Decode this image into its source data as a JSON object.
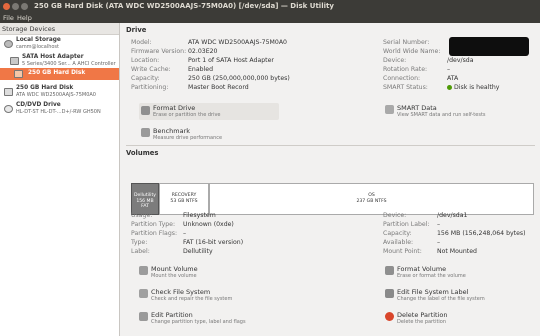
{
  "window": {
    "title": "250 GB Hard Disk (ATA WDC WD2500AAJS-75M0A0) [/dev/sda] — Disk Utility"
  },
  "menu": {
    "file": "File",
    "help": "Help"
  },
  "sidebar": {
    "header": "Storage Devices",
    "items": [
      {
        "name": "Local Storage",
        "sub": "camm@localhost"
      },
      {
        "name": "SATA Host Adapter",
        "sub": "5 Series/3400 Ser... A AHCI Controller"
      },
      {
        "name": "250 GB Hard Disk",
        "sub": ""
      },
      {
        "name": "250 GB Hard Disk",
        "sub": "ATA WDC WD2500AAJS-75M0A0"
      },
      {
        "name": "CD/DVD Drive",
        "sub": "HL-DT-ST HL-DT-...D+/-RW GH50N"
      }
    ]
  },
  "drive": {
    "section": "Drive",
    "left": [
      {
        "label": "Model:",
        "value": "ATA WDC WD2500AAJS-75M0A0"
      },
      {
        "label": "Firmware Version:",
        "value": "02.03E20"
      },
      {
        "label": "Location:",
        "value": "Port 1 of SATA Host Adapter"
      },
      {
        "label": "Write Cache:",
        "value": "Enabled"
      },
      {
        "label": "Capacity:",
        "value": "250 GB (250,000,000,000 bytes)"
      },
      {
        "label": "Partitioning:",
        "value": "Master Boot Record"
      }
    ],
    "right": [
      {
        "label": "Serial Number:",
        "value": ""
      },
      {
        "label": "World Wide Name:",
        "value": ""
      },
      {
        "label": "Device:",
        "value": "/dev/sda"
      },
      {
        "label": "Rotation Rate:",
        "value": "–"
      },
      {
        "label": "Connection:",
        "value": "ATA"
      },
      {
        "label": "SMART Status:",
        "value": "Disk is healthy"
      }
    ],
    "actions": [
      {
        "title": "Format Drive",
        "sub": "Erase or partition the drive"
      },
      {
        "title": "SMART Data",
        "sub": "View SMART data and run self-tests"
      },
      {
        "title": "Benchmark",
        "sub": "Measure drive performance"
      }
    ]
  },
  "volumes": {
    "section": "Volumes",
    "map": [
      {
        "name": "Dellutility",
        "size": "156 MB FAT"
      },
      {
        "name": "RECOVERY",
        "size": "53 GB NTFS"
      },
      {
        "name": "OS",
        "size": "237 GB NTFS"
      }
    ],
    "left": [
      {
        "label": "Usage:",
        "value": "Filesystem"
      },
      {
        "label": "Partition Type:",
        "value": "Unknown (0xde)"
      },
      {
        "label": "Partition Flags:",
        "value": "–"
      },
      {
        "label": "Type:",
        "value": "FAT (16-bit version)"
      },
      {
        "label": "Label:",
        "value": "Dellutility"
      }
    ],
    "right": [
      {
        "label": "Device:",
        "value": "/dev/sda1"
      },
      {
        "label": "Partition Label:",
        "value": "–"
      },
      {
        "label": "Capacity:",
        "value": "156 MB (156,248,064 bytes)"
      },
      {
        "label": "Available:",
        "value": "–"
      },
      {
        "label": "Mount Point:",
        "value": "Not Mounted"
      }
    ],
    "actions": [
      {
        "title": "Mount Volume",
        "sub": "Mount the volume"
      },
      {
        "title": "Format Volume",
        "sub": "Erase or format the volume"
      },
      {
        "title": "Check File System",
        "sub": "Check and repair the file system"
      },
      {
        "title": "Edit File System Label",
        "sub": "Change the label of the file system"
      },
      {
        "title": "Edit Partition",
        "sub": "Change partition type, label and flags"
      },
      {
        "title": "Delete Partition",
        "sub": "Delete the partition"
      }
    ]
  }
}
